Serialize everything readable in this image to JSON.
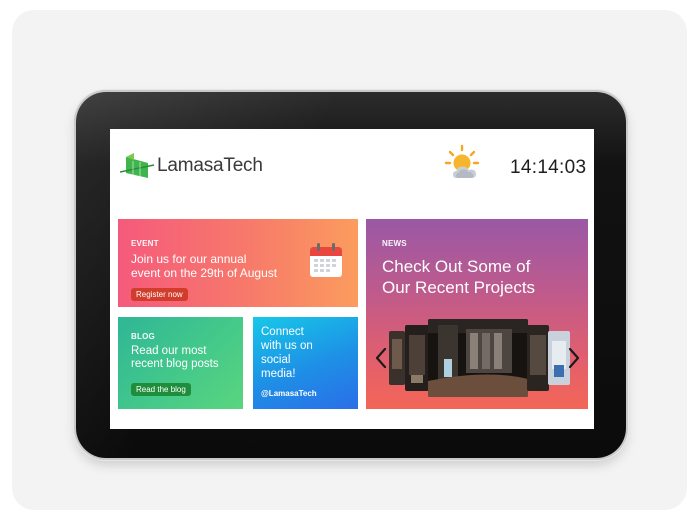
{
  "screen": {
    "logo_text": "LamasaTech",
    "clock": "14:14:03",
    "weather_icon": "partly-cloudy-icon"
  },
  "event": {
    "tag": "EVENT",
    "line1": "Join us for our annual",
    "line2": "event on the 29th of August",
    "button": "Register now",
    "icon": "calendar-icon"
  },
  "blog": {
    "tag": "BLOG",
    "line1": "Read our most",
    "line2": "recent blog posts",
    "button": "Read the blog"
  },
  "social": {
    "line1": "Connect",
    "line2": "with us on",
    "line3": "social",
    "line4": "media!",
    "handle": "@LamasaTech"
  },
  "news": {
    "tag": "NEWS",
    "line1": "Check Out Some of",
    "line2": "Our Recent Projects",
    "prev_icon": "chevron-left-icon",
    "next_icon": "chevron-right-icon"
  },
  "colors": {
    "event": "#f77a6a",
    "blog": "#44c98a",
    "social": "#1e8fe6",
    "news": "#bb5a8f"
  }
}
